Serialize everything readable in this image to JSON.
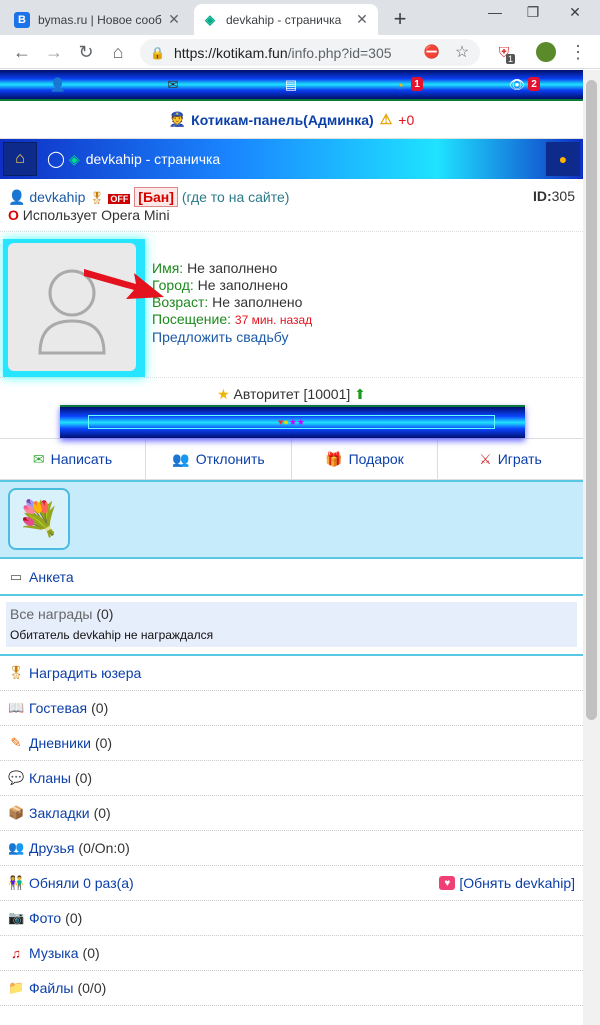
{
  "browser": {
    "tabs": [
      {
        "favicon": "B",
        "title": "bymas.ru | Новое сооб",
        "active": false
      },
      {
        "favicon": "◈",
        "title": "devkahip - страничка",
        "active": true
      }
    ],
    "url_main": "https://kotikam.fun",
    "url_rest": "/info.php?id=305",
    "ext_badge": "1"
  },
  "topnav": {
    "rss_count": "1",
    "guests_count": "2"
  },
  "admin_panel": {
    "label": "Котикам-панель(Админка)",
    "warn_count": "+0"
  },
  "page_title": "devkahip - страничка",
  "user": {
    "nick": "devkahip",
    "off_badge": "OFF",
    "ban": "[Бан]",
    "where": "(где то на сайте)",
    "id_label": "ID:",
    "id_value": "305",
    "browser_line": "Использует Opera Mini"
  },
  "profile": {
    "name_label": "Имя:",
    "name_value": "Не заполнено",
    "city_label": "Город:",
    "city_value": "Не заполнено",
    "age_label": "Возраст:",
    "age_value": "Не заполнено",
    "visit_label": "Посещение:",
    "visit_value": "37 мин. назад",
    "propose": "Предложить свадьбу"
  },
  "rating": {
    "label": "Авторитет",
    "value": "[10001]"
  },
  "actions": [
    {
      "label": "Написать",
      "icon": "envelope-icon"
    },
    {
      "label": "Отклонить",
      "icon": "users-icon"
    },
    {
      "label": "Подарок",
      "icon": "gift-icon"
    },
    {
      "label": "Играть",
      "icon": "swords-icon"
    }
  ],
  "anketa": "Анкета",
  "awards": {
    "title": "Все награды",
    "count": "(0)",
    "empty": "Обитатель devkahip не награждался"
  },
  "menu": [
    {
      "label": "Наградить юзера",
      "count": "",
      "icon": "medal-icon"
    },
    {
      "label": "Гостевая",
      "count": "(0)",
      "icon": "book-icon"
    },
    {
      "label": "Дневники",
      "count": "(0)",
      "icon": "pencil-icon"
    },
    {
      "label": "Кланы",
      "count": "(0)",
      "icon": "chat-icon"
    },
    {
      "label": "Закладки",
      "count": "(0)",
      "icon": "box-icon"
    },
    {
      "label": "Друзья",
      "count": "(0/On:0)",
      "icon": "friends-icon"
    },
    {
      "label": "Обняли 0 раз(а)",
      "count": "",
      "icon": "hug-icon"
    },
    {
      "label": "Фото",
      "count": "(0)",
      "icon": "camera-icon"
    },
    {
      "label": "Музыка",
      "count": "(0)",
      "icon": "music-icon"
    },
    {
      "label": "Файлы",
      "count": "(0/0)",
      "icon": "folder-icon"
    }
  ],
  "hug_action": "[Обнять devkahip]"
}
